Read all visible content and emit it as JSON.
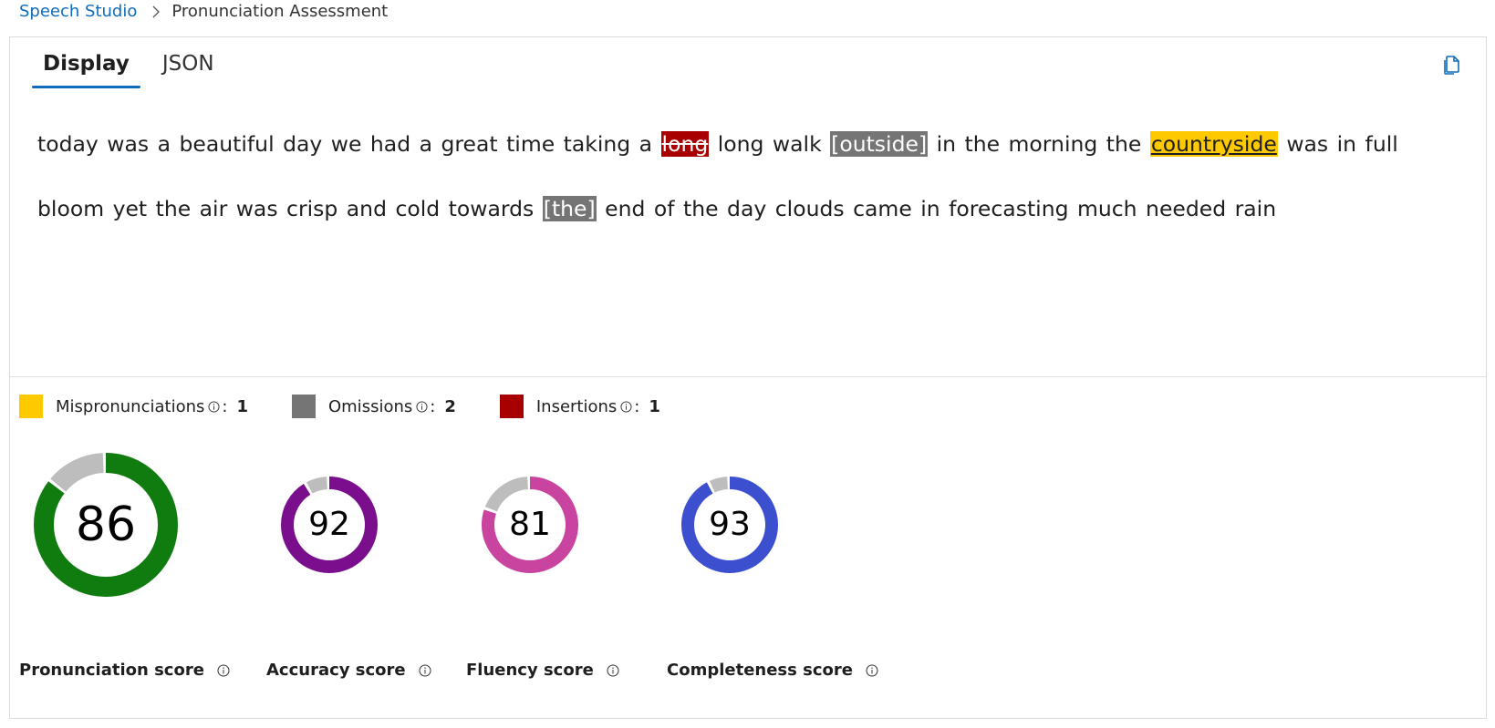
{
  "breadcrumb": {
    "root": "Speech Studio",
    "current": "Pronunciation Assessment"
  },
  "tabs": [
    {
      "label": "Display"
    },
    {
      "label": "JSON"
    }
  ],
  "transcript": {
    "s1": "today was a beautiful day we had a great time taking a ",
    "insertion1": "long",
    "s2": " long walk ",
    "omission1": "[outside]",
    "s3": " in the morning the ",
    "mispronunciation1": "countryside",
    "s4": " was in full bloom yet the air was crisp and cold towards ",
    "omission2": "[the]",
    "s5": " end of the day clouds came in forecasting much needed rain"
  },
  "legend": {
    "mispronunciations": {
      "label": "Mispronunciations",
      "sep": ":",
      "count": "1",
      "color": "#ffc900"
    },
    "omissions": {
      "label": "Omissions",
      "sep": ":",
      "count": "2",
      "color": "#757575"
    },
    "insertions": {
      "label": "Insertions",
      "sep": ":",
      "count": "1",
      "color": "#a80000"
    }
  },
  "scores": {
    "pronunciation": {
      "value": "86",
      "label": "Pronunciation score",
      "color": "#107c10"
    },
    "accuracy": {
      "value": "92",
      "label": "Accuracy score",
      "color": "#7a0e8c"
    },
    "fluency": {
      "value": "81",
      "label": "Fluency score",
      "color": "#c8449e"
    },
    "completeness": {
      "value": "93",
      "label": "Completeness score",
      "color": "#3c4fcf"
    }
  },
  "colors": {
    "accent": "#0f6cbd",
    "gauge_remainder": "#bdbdbd"
  }
}
